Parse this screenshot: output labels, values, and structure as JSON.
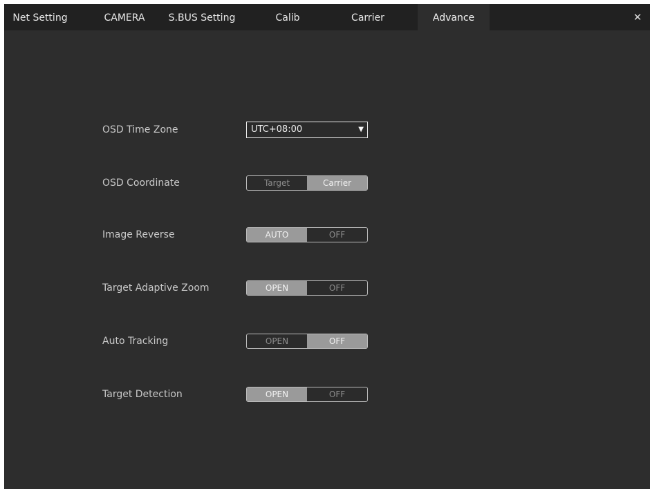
{
  "tabs": [
    {
      "label": "Net Setting"
    },
    {
      "label": "CAMERA"
    },
    {
      "label": "S.BUS Setting"
    },
    {
      "label": "Calib"
    },
    {
      "label": "Carrier"
    },
    {
      "label": "Advance",
      "active": true
    }
  ],
  "close_glyph": "✕",
  "settings": {
    "osd_time_zone": {
      "label": "OSD Time Zone",
      "value": "UTC+08:00",
      "caret": "▼"
    },
    "osd_coordinate": {
      "label": "OSD Coordinate",
      "options": [
        "Target",
        "Carrier"
      ],
      "selected": "Carrier"
    },
    "image_reverse": {
      "label": "Image Reverse",
      "options": [
        "AUTO",
        "OFF"
      ],
      "selected": "AUTO"
    },
    "target_adaptive_zoom": {
      "label": "Target Adaptive Zoom",
      "options": [
        "OPEN",
        "OFF"
      ],
      "selected": "OPEN"
    },
    "auto_tracking": {
      "label": "Auto Tracking",
      "options": [
        "OPEN",
        "OFF"
      ],
      "selected": "OFF"
    },
    "target_detection": {
      "label": "Target Detection",
      "options": [
        "OPEN",
        "OFF"
      ],
      "selected": "OPEN"
    }
  },
  "colors": {
    "background": "#2d2d2d",
    "tabbar": "#212121",
    "selected_segment": "#9a9a9a"
  }
}
